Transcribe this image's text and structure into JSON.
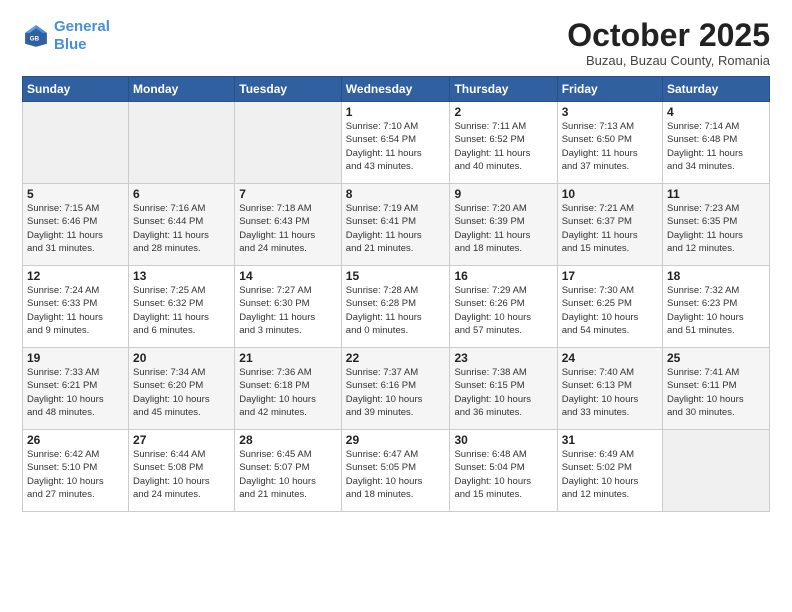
{
  "header": {
    "logo_line1": "General",
    "logo_line2": "Blue",
    "month": "October 2025",
    "location": "Buzau, Buzau County, Romania"
  },
  "weekdays": [
    "Sunday",
    "Monday",
    "Tuesday",
    "Wednesday",
    "Thursday",
    "Friday",
    "Saturday"
  ],
  "weeks": [
    [
      {
        "day": "",
        "info": ""
      },
      {
        "day": "",
        "info": ""
      },
      {
        "day": "",
        "info": ""
      },
      {
        "day": "1",
        "info": "Sunrise: 7:10 AM\nSunset: 6:54 PM\nDaylight: 11 hours\nand 43 minutes."
      },
      {
        "day": "2",
        "info": "Sunrise: 7:11 AM\nSunset: 6:52 PM\nDaylight: 11 hours\nand 40 minutes."
      },
      {
        "day": "3",
        "info": "Sunrise: 7:13 AM\nSunset: 6:50 PM\nDaylight: 11 hours\nand 37 minutes."
      },
      {
        "day": "4",
        "info": "Sunrise: 7:14 AM\nSunset: 6:48 PM\nDaylight: 11 hours\nand 34 minutes."
      }
    ],
    [
      {
        "day": "5",
        "info": "Sunrise: 7:15 AM\nSunset: 6:46 PM\nDaylight: 11 hours\nand 31 minutes."
      },
      {
        "day": "6",
        "info": "Sunrise: 7:16 AM\nSunset: 6:44 PM\nDaylight: 11 hours\nand 28 minutes."
      },
      {
        "day": "7",
        "info": "Sunrise: 7:18 AM\nSunset: 6:43 PM\nDaylight: 11 hours\nand 24 minutes."
      },
      {
        "day": "8",
        "info": "Sunrise: 7:19 AM\nSunset: 6:41 PM\nDaylight: 11 hours\nand 21 minutes."
      },
      {
        "day": "9",
        "info": "Sunrise: 7:20 AM\nSunset: 6:39 PM\nDaylight: 11 hours\nand 18 minutes."
      },
      {
        "day": "10",
        "info": "Sunrise: 7:21 AM\nSunset: 6:37 PM\nDaylight: 11 hours\nand 15 minutes."
      },
      {
        "day": "11",
        "info": "Sunrise: 7:23 AM\nSunset: 6:35 PM\nDaylight: 11 hours\nand 12 minutes."
      }
    ],
    [
      {
        "day": "12",
        "info": "Sunrise: 7:24 AM\nSunset: 6:33 PM\nDaylight: 11 hours\nand 9 minutes."
      },
      {
        "day": "13",
        "info": "Sunrise: 7:25 AM\nSunset: 6:32 PM\nDaylight: 11 hours\nand 6 minutes."
      },
      {
        "day": "14",
        "info": "Sunrise: 7:27 AM\nSunset: 6:30 PM\nDaylight: 11 hours\nand 3 minutes."
      },
      {
        "day": "15",
        "info": "Sunrise: 7:28 AM\nSunset: 6:28 PM\nDaylight: 11 hours\nand 0 minutes."
      },
      {
        "day": "16",
        "info": "Sunrise: 7:29 AM\nSunset: 6:26 PM\nDaylight: 10 hours\nand 57 minutes."
      },
      {
        "day": "17",
        "info": "Sunrise: 7:30 AM\nSunset: 6:25 PM\nDaylight: 10 hours\nand 54 minutes."
      },
      {
        "day": "18",
        "info": "Sunrise: 7:32 AM\nSunset: 6:23 PM\nDaylight: 10 hours\nand 51 minutes."
      }
    ],
    [
      {
        "day": "19",
        "info": "Sunrise: 7:33 AM\nSunset: 6:21 PM\nDaylight: 10 hours\nand 48 minutes."
      },
      {
        "day": "20",
        "info": "Sunrise: 7:34 AM\nSunset: 6:20 PM\nDaylight: 10 hours\nand 45 minutes."
      },
      {
        "day": "21",
        "info": "Sunrise: 7:36 AM\nSunset: 6:18 PM\nDaylight: 10 hours\nand 42 minutes."
      },
      {
        "day": "22",
        "info": "Sunrise: 7:37 AM\nSunset: 6:16 PM\nDaylight: 10 hours\nand 39 minutes."
      },
      {
        "day": "23",
        "info": "Sunrise: 7:38 AM\nSunset: 6:15 PM\nDaylight: 10 hours\nand 36 minutes."
      },
      {
        "day": "24",
        "info": "Sunrise: 7:40 AM\nSunset: 6:13 PM\nDaylight: 10 hours\nand 33 minutes."
      },
      {
        "day": "25",
        "info": "Sunrise: 7:41 AM\nSunset: 6:11 PM\nDaylight: 10 hours\nand 30 minutes."
      }
    ],
    [
      {
        "day": "26",
        "info": "Sunrise: 6:42 AM\nSunset: 5:10 PM\nDaylight: 10 hours\nand 27 minutes."
      },
      {
        "day": "27",
        "info": "Sunrise: 6:44 AM\nSunset: 5:08 PM\nDaylight: 10 hours\nand 24 minutes."
      },
      {
        "day": "28",
        "info": "Sunrise: 6:45 AM\nSunset: 5:07 PM\nDaylight: 10 hours\nand 21 minutes."
      },
      {
        "day": "29",
        "info": "Sunrise: 6:47 AM\nSunset: 5:05 PM\nDaylight: 10 hours\nand 18 minutes."
      },
      {
        "day": "30",
        "info": "Sunrise: 6:48 AM\nSunset: 5:04 PM\nDaylight: 10 hours\nand 15 minutes."
      },
      {
        "day": "31",
        "info": "Sunrise: 6:49 AM\nSunset: 5:02 PM\nDaylight: 10 hours\nand 12 minutes."
      },
      {
        "day": "",
        "info": ""
      }
    ]
  ]
}
